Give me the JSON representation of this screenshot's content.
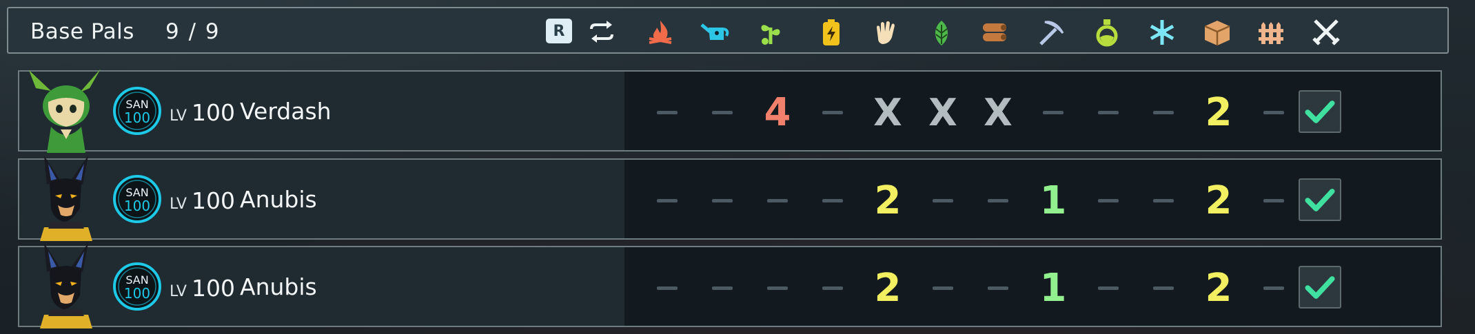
{
  "header": {
    "title": "Base Pals",
    "count": "9 / 9",
    "sort_key": "R",
    "sort_icon": "swap-arrows-icon",
    "work_columns": [
      {
        "name": "kindling",
        "icon": "flame-icon",
        "color": "#f06b4a"
      },
      {
        "name": "watering",
        "icon": "watering-can-icon",
        "color": "#2ec6e6"
      },
      {
        "name": "planting",
        "icon": "sprout-icon",
        "color": "#9be04a"
      },
      {
        "name": "electricity",
        "icon": "battery-bolt-icon",
        "color": "#f2c21c"
      },
      {
        "name": "handiwork",
        "icon": "hand-icon",
        "color": "#f4dfb8"
      },
      {
        "name": "gathering",
        "icon": "leaf-icon",
        "color": "#4fb84a"
      },
      {
        "name": "lumbering",
        "icon": "logs-icon",
        "color": "#c47a3e"
      },
      {
        "name": "mining",
        "icon": "pickaxe-icon",
        "color": "#b9c8e6"
      },
      {
        "name": "medicine",
        "icon": "potion-flask-icon",
        "color": "#b6dc3e"
      },
      {
        "name": "cooling",
        "icon": "snowflake-icon",
        "color": "#7de6f4"
      },
      {
        "name": "transporting",
        "icon": "crate-icon",
        "color": "#e3a469"
      },
      {
        "name": "farming",
        "icon": "fence-icon",
        "color": "#f0b58c"
      },
      {
        "name": "combat",
        "icon": "crossed-swords-icon",
        "color": "#eef3f4"
      }
    ]
  },
  "pals": [
    {
      "name": "Verdash",
      "lv_label": "LV",
      "level": "100",
      "san_label": "SAN",
      "san_value": "100",
      "portrait": "verdash-portrait",
      "work": [
        "—",
        "—",
        "4",
        "—",
        "X",
        "X",
        "X",
        "—",
        "—",
        "—",
        "2",
        "—"
      ],
      "work_kinds": [
        "dash",
        "dash",
        "red",
        "dash",
        "x",
        "x",
        "x",
        "dash",
        "dash",
        "dash",
        "yellow",
        "dash"
      ],
      "checked": true
    },
    {
      "name": "Anubis",
      "lv_label": "LV",
      "level": "100",
      "san_label": "SAN",
      "san_value": "100",
      "portrait": "anubis-portrait",
      "work": [
        "—",
        "—",
        "—",
        "—",
        "2",
        "—",
        "—",
        "1",
        "—",
        "—",
        "2",
        "—"
      ],
      "work_kinds": [
        "dash",
        "dash",
        "dash",
        "dash",
        "yellow",
        "dash",
        "dash",
        "green",
        "dash",
        "dash",
        "yellow",
        "dash"
      ],
      "checked": true
    },
    {
      "name": "Anubis",
      "lv_label": "LV",
      "level": "100",
      "san_label": "SAN",
      "san_value": "100",
      "portrait": "anubis-portrait",
      "work": [
        "—",
        "—",
        "—",
        "—",
        "2",
        "—",
        "—",
        "1",
        "—",
        "—",
        "2",
        "—"
      ],
      "work_kinds": [
        "dash",
        "dash",
        "dash",
        "dash",
        "yellow",
        "dash",
        "dash",
        "green",
        "dash",
        "dash",
        "yellow",
        "dash"
      ],
      "checked": true
    }
  ],
  "colors": {
    "san_ring": "#1ec9e8",
    "check": "#3fe0a0",
    "level_red": "#f07f6c",
    "level_yellow": "#f2f060",
    "level_green": "#93f08e"
  }
}
